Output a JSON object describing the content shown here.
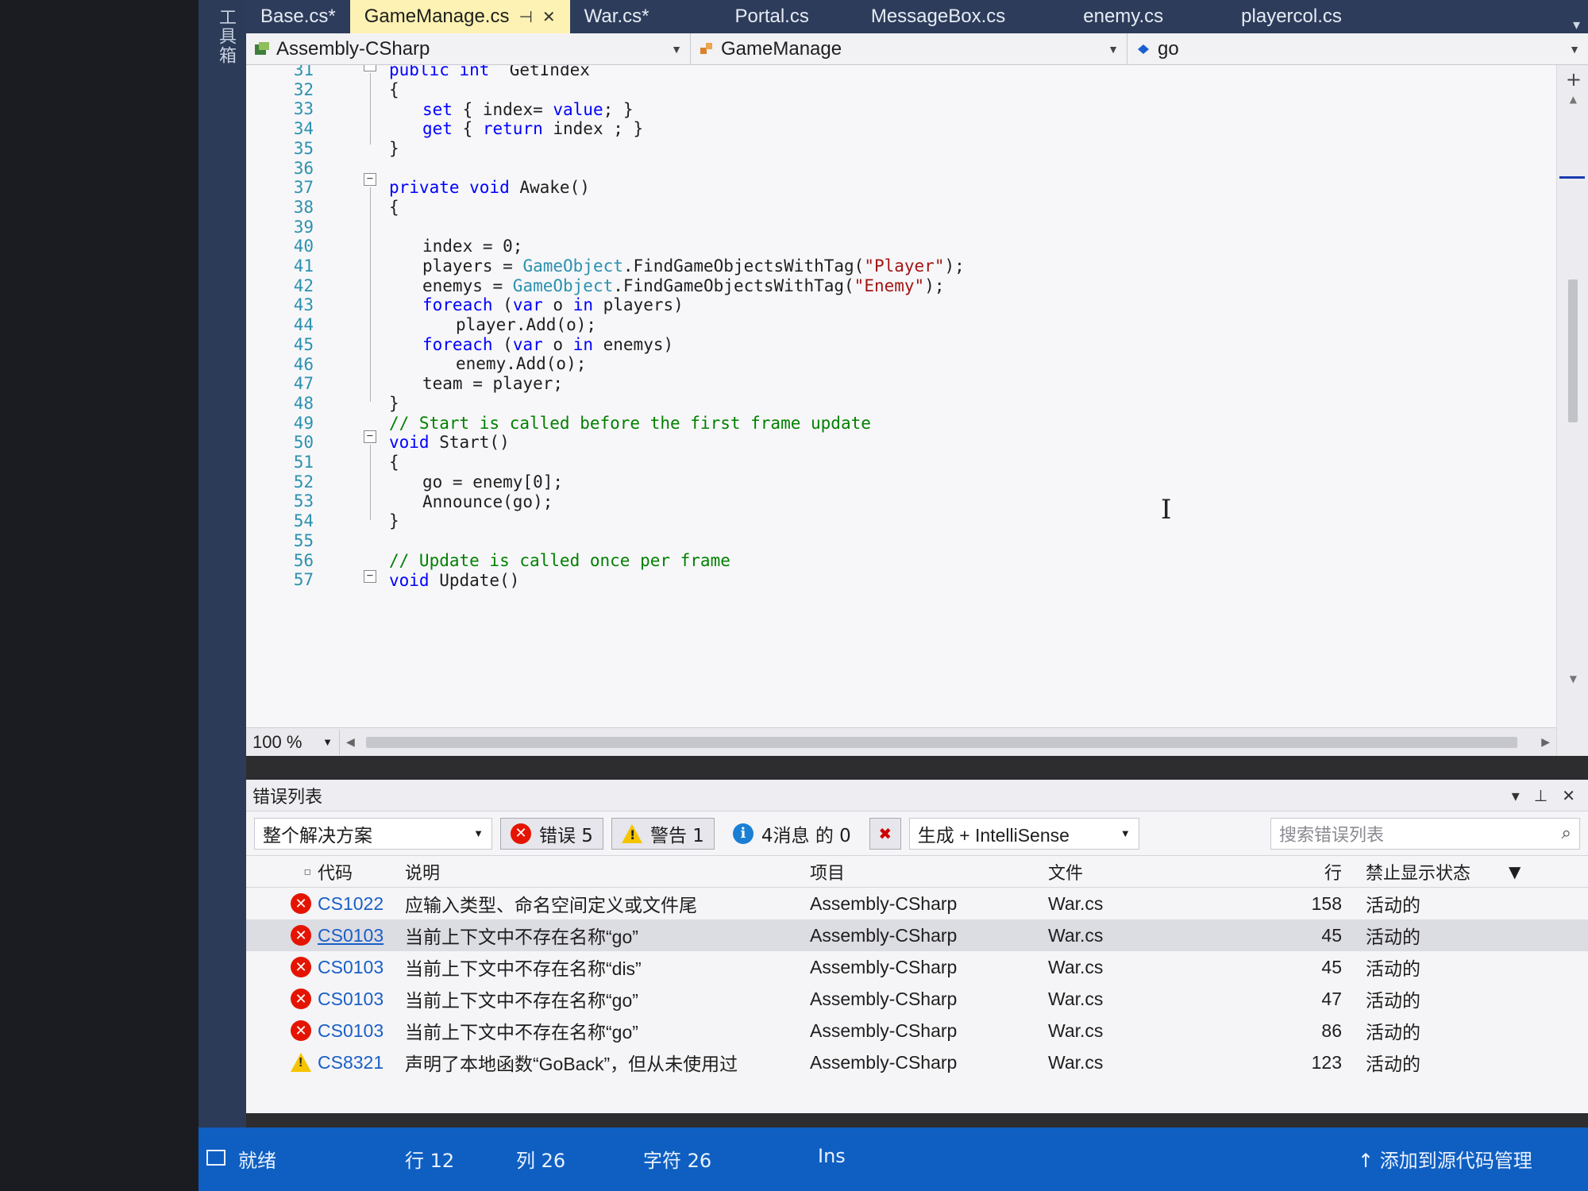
{
  "toolbox": {
    "label": "工具箱"
  },
  "tabs": [
    {
      "label": "Base.cs*",
      "active": false
    },
    {
      "label": "GameManage.cs",
      "active": true
    },
    {
      "label": "War.cs*",
      "active": false
    },
    {
      "label": "Portal.cs",
      "active": false
    },
    {
      "label": "MessageBox.cs",
      "active": false
    },
    {
      "label": "enemy.cs",
      "active": false
    },
    {
      "label": "playercol.cs",
      "active": false
    }
  ],
  "navbar": {
    "project": "Assembly-CSharp",
    "type": "GameManage",
    "member": "go"
  },
  "editor": {
    "line_numbers": [
      "31",
      "32",
      "33",
      "34",
      "35",
      "36",
      "37",
      "38",
      "39",
      "40",
      "41",
      "42",
      "43",
      "44",
      "45",
      "46",
      "47",
      "48",
      "49",
      "50",
      "51",
      "52",
      "53",
      "54",
      "55",
      "56",
      "57"
    ],
    "code": {
      "l31_kw": "public int",
      "l31_rest": "  GetIndex",
      "l32": "{",
      "l33_kw1": "set",
      "l33_a": " { index= ",
      "l33_kw2": "value",
      "l33_b": "; }",
      "l34_kw1": "get",
      "l34_a": " { ",
      "l34_kw2": "return",
      "l34_b": " index ; }",
      "l35": "}",
      "l37_kw": "private void",
      "l37_rest": " Awake()",
      "l38": "{",
      "l40": "index = 0;",
      "l41_a": "players = ",
      "l41_ty": "GameObject",
      "l41_b": ".FindGameObjectsWithTag(",
      "l41_str": "\"Player\"",
      "l41_c": ");",
      "l42_a": "enemys = ",
      "l42_ty": "GameObject",
      "l42_b": ".FindGameObjectsWithTag(",
      "l42_str": "\"Enemy\"",
      "l42_c": ");",
      "l43_kw1": "foreach",
      "l43_a": " (",
      "l43_kw2": "var",
      "l43_b": " o ",
      "l43_kw3": "in",
      "l43_c": " players)",
      "l44": "player.Add(o);",
      "l45_kw1": "foreach",
      "l45_a": " (",
      "l45_kw2": "var",
      "l45_b": " o ",
      "l45_kw3": "in",
      "l45_c": " enemys)",
      "l46": "enemy.Add(o);",
      "l47": "team = player;",
      "l48": "}",
      "l49": "// Start is called before the first frame update",
      "l50_kw": "void",
      "l50_rest": " Start()",
      "l51": "{",
      "l52": "go = enemy[0];",
      "l53": "Announce(go);",
      "l54": "}",
      "l56": "// Update is called once per frame",
      "l57_kw": "void",
      "l57_rest": " Update()"
    },
    "zoom": "100 %"
  },
  "error_list": {
    "title": "错误列表",
    "scope": "整个解决方案",
    "errors_btn": "错误 5",
    "warnings_btn": "警告 1",
    "messages_btn": "4消息 的 0",
    "build_filter": "生成 + IntelliSense",
    "search_placeholder": "搜索错误列表",
    "columns": {
      "code": "代码",
      "description": "说明",
      "project": "项目",
      "file": "文件",
      "line": "行",
      "suppression": "禁止显示状态"
    },
    "rows": [
      {
        "severity": "error",
        "code": "CS1022",
        "description": "应输入类型、命名空间定义或文件尾",
        "project": "Assembly-CSharp",
        "file": "War.cs",
        "line": "158",
        "state": "活动的"
      },
      {
        "severity": "error",
        "code": "CS0103",
        "description": "当前上下文中不存在名称“go”",
        "project": "Assembly-CSharp",
        "file": "War.cs",
        "line": "45",
        "state": "活动的"
      },
      {
        "severity": "error",
        "code": "CS0103",
        "description": "当前上下文中不存在名称“dis”",
        "project": "Assembly-CSharp",
        "file": "War.cs",
        "line": "45",
        "state": "活动的"
      },
      {
        "severity": "error",
        "code": "CS0103",
        "description": "当前上下文中不存在名称“go”",
        "project": "Assembly-CSharp",
        "file": "War.cs",
        "line": "47",
        "state": "活动的"
      },
      {
        "severity": "error",
        "code": "CS0103",
        "description": "当前上下文中不存在名称“go”",
        "project": "Assembly-CSharp",
        "file": "War.cs",
        "line": "86",
        "state": "活动的"
      },
      {
        "severity": "warning",
        "code": "CS8321",
        "description": "声明了本地函数“GoBack”，但从未使用过",
        "project": "Assembly-CSharp",
        "file": "War.cs",
        "line": "123",
        "state": "活动的"
      }
    ]
  },
  "status": {
    "ready": "就绪",
    "line": "行 12",
    "col": "列 26",
    "char": "字符 26",
    "ins": "Ins",
    "source_control": "添加到源代码管理"
  },
  "colors": {
    "status_bar": "#0f5fc2",
    "active_tab": "#fdf2b3",
    "keyword": "#0000ff",
    "type": "#2b91af",
    "string": "#a31515",
    "comment": "#008000",
    "error_icon": "#e51400",
    "warning_icon": "#f5c400"
  }
}
